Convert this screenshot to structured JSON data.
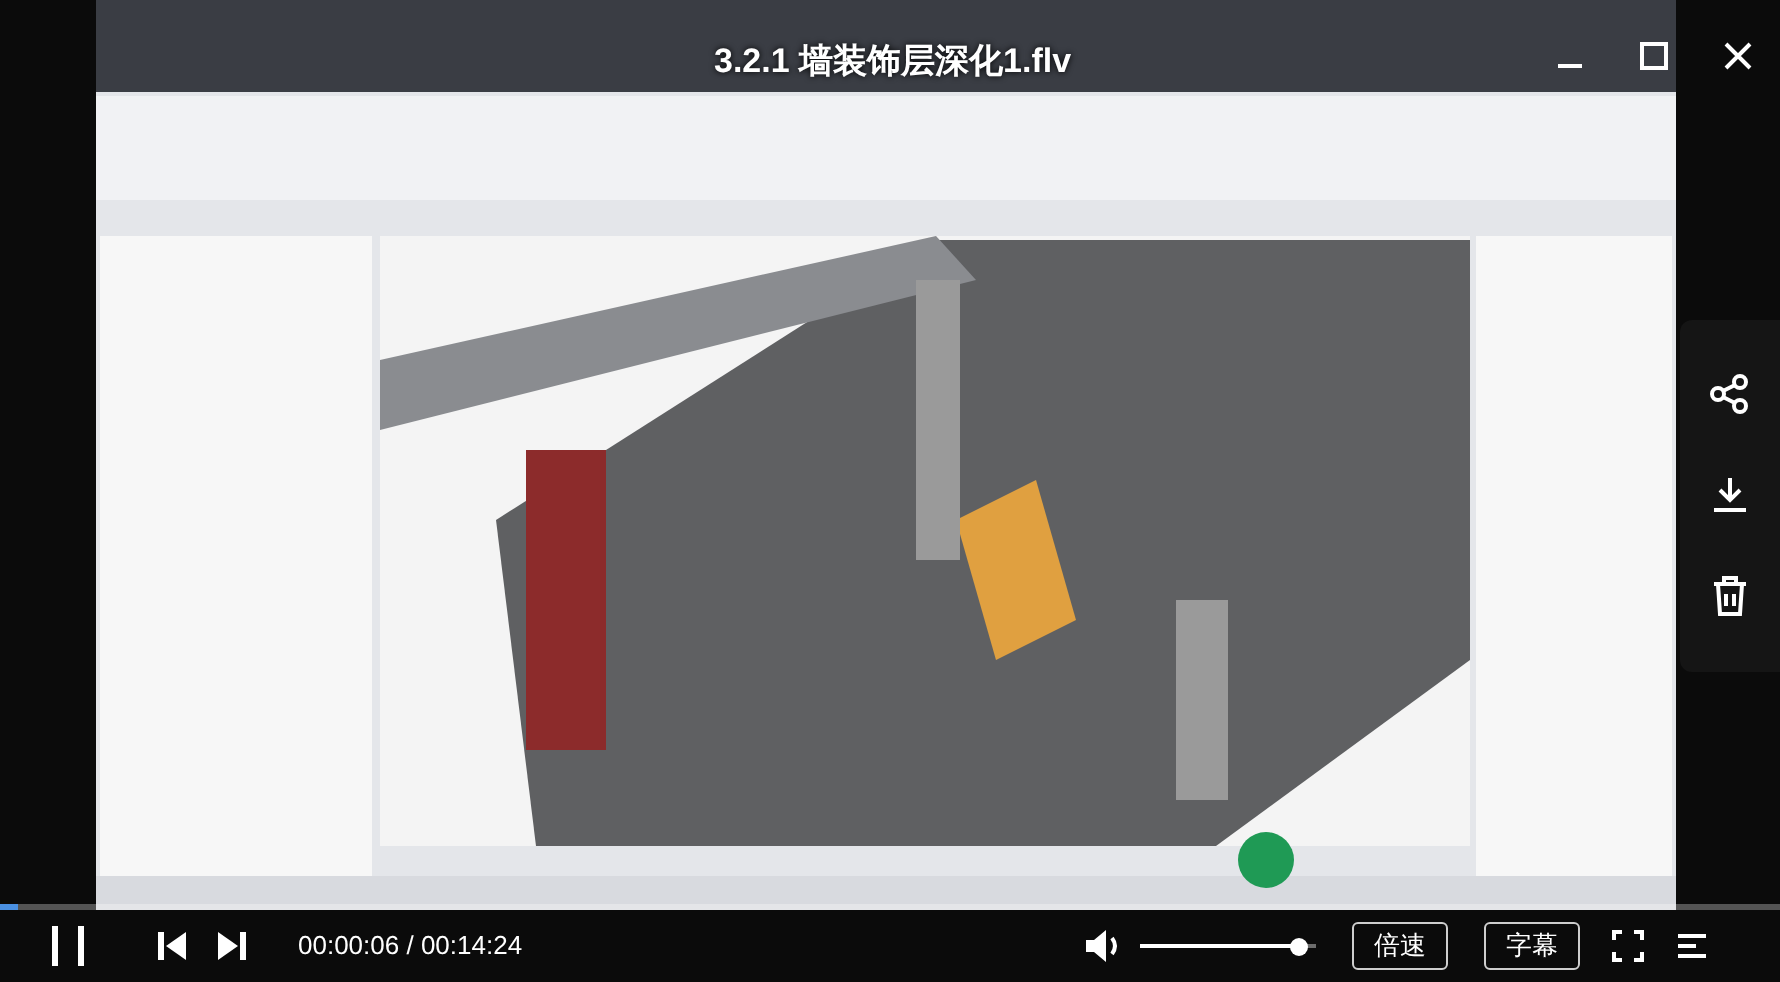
{
  "video": {
    "kind": "picture",
    "title": "3.2.1 墙装饰层深化1.flv",
    "progress": {
      "level": 0.01
    }
  },
  "window_controls": [
    {
      "kind": "minimize"
    },
    {
      "kind": "maximize"
    },
    {
      "kind": "close"
    }
  ],
  "side_actions": [
    {
      "kind": "share"
    },
    {
      "kind": "download"
    },
    {
      "kind": "delete"
    }
  ],
  "controls": {
    "playing": true,
    "current_time": "00:00:06",
    "separator": "/",
    "duration": "00:14:24",
    "volume": {
      "level": 0.9
    },
    "buttons": [
      {
        "label": "倍速"
      },
      {
        "label": "字幕"
      }
    ]
  }
}
